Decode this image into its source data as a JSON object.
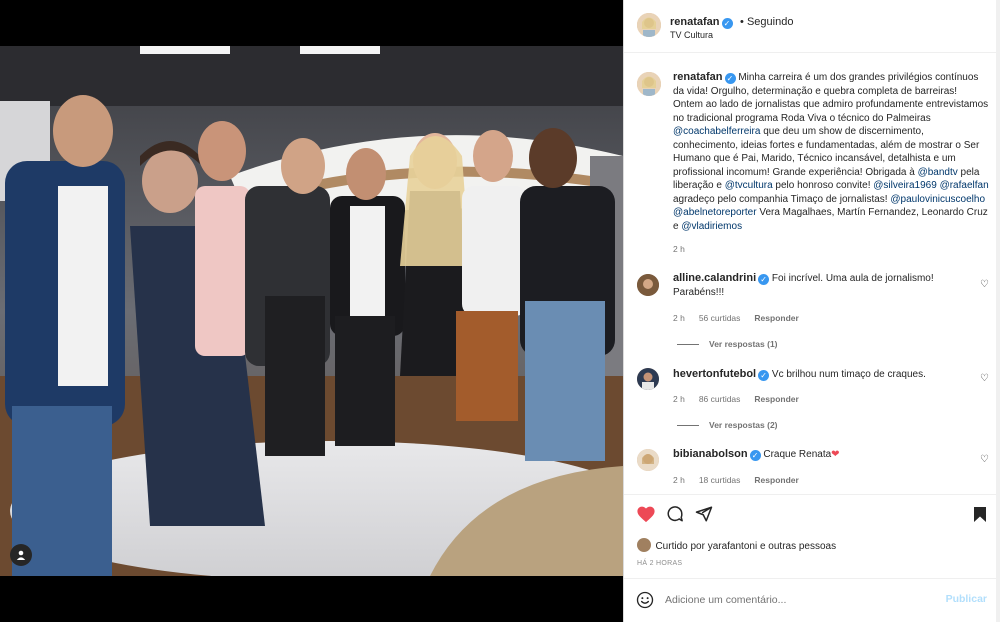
{
  "post": {
    "author": "renatafan",
    "follow_status": "Seguindo",
    "location": "TV Cultura"
  },
  "caption": {
    "author": "renatafan",
    "parts": [
      {
        "t": "Minha carreira é um dos grandes privilégios contínuos da vida! Orgulho, determinação e quebra completa de barreiras! Ontem ao lado de jornalistas que admiro profundamente entrevistamos no tradicional programa Roda Viva o técnico do Palmeiras ",
        "m": false
      },
      {
        "t": "@coachabelferreira",
        "m": true
      },
      {
        "t": " que deu um show de discernimento, conhecimento, ideias fortes e fundamentadas, além de mostrar o Ser Humano que é Pai, Marido, Técnico incansável, detalhista e um profissional incomum! Grande experiência! Obrigada à ",
        "m": false
      },
      {
        "t": "@bandtv",
        "m": true
      },
      {
        "t": " pela liberação e ",
        "m": false
      },
      {
        "t": "@tvcultura",
        "m": true
      },
      {
        "t": " pelo honroso convite! ",
        "m": false
      },
      {
        "t": "@silveira1969",
        "m": true
      },
      {
        "t": " ",
        "m": false
      },
      {
        "t": "@rafaelfan",
        "m": true
      },
      {
        "t": " agradeço pelo companhia Timaço de jornalistas! ",
        "m": false
      },
      {
        "t": "@paulovinicuscoelho",
        "m": true
      },
      {
        "t": " ",
        "m": false
      },
      {
        "t": "@abelnetoreporter",
        "m": true
      },
      {
        "t": " Vera Magalhaes, Martín Fernandez, Leonardo Cruz e ",
        "m": false
      },
      {
        "t": "@vladiriemos",
        "m": true
      }
    ],
    "time": "2 h"
  },
  "comments": [
    {
      "user": "alline.calandrini",
      "text": "Foi incrível. Uma aula de jornalismo! Parabéns!!!",
      "time": "2 h",
      "likes": "56 curtidas",
      "reply": "Responder",
      "view_replies": "Ver respostas (1)"
    },
    {
      "user": "hevertonfutebol",
      "text": "Vc brilhou num timaço de craques.",
      "time": "2 h",
      "likes": "86 curtidas",
      "reply": "Responder",
      "view_replies": "Ver respostas (2)"
    },
    {
      "user": "bibianabolson",
      "text": "Craque Renata",
      "emoji": "❤",
      "time": "2 h",
      "likes": "18 curtidas",
      "reply": "Responder"
    }
  ],
  "likes": {
    "text": "Curtido por yarafantoni e outras pessoas"
  },
  "time_ago": "HÁ 2 HORAS",
  "comment_box": {
    "placeholder": "Adicione um comentário...",
    "publish": "Publicar"
  },
  "icons": {
    "like": "heart-filled-icon",
    "comment": "comment-bubble-icon",
    "share": "paper-plane-icon",
    "save": "bookmark-filled-icon",
    "emoji": "smiley-icon",
    "tag": "person-tag-icon"
  },
  "colors": {
    "heart": "#ed4956",
    "verified": "#3897f0",
    "mention": "#00376b",
    "publish_disabled": "#b2dffc"
  }
}
